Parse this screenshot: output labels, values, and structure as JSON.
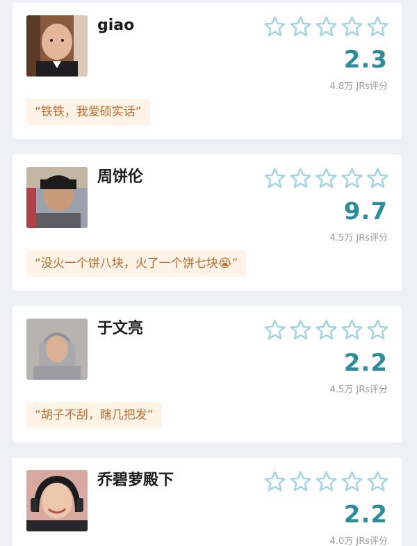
{
  "ratings": [
    {
      "name": "giao",
      "score": "2.3",
      "count": "4.8万 JRs评分",
      "quote": "“铁铁，我爱硕实话”"
    },
    {
      "name": "周饼伦",
      "score": "9.7",
      "count": "4.5万 JRs评分",
      "quote": "“没火一个饼八块，火了一个饼七块😭”"
    },
    {
      "name": "于文亮",
      "score": "2.2",
      "count": "4.5万 JRs评分",
      "quote": "“胡子不刮，瞎几把发”"
    },
    {
      "name": "乔碧萝殿下",
      "score": "2.2",
      "count": "4.0万 JRs评分",
      "quote": ""
    }
  ],
  "max_stars": 5,
  "colors": {
    "star_outline": "#9fd4e0",
    "score": "#2b8c9a",
    "quote_bg": "#fdf3e6",
    "quote_text": "#b86b2d"
  },
  "icons": {
    "star": "star-outline-icon"
  }
}
